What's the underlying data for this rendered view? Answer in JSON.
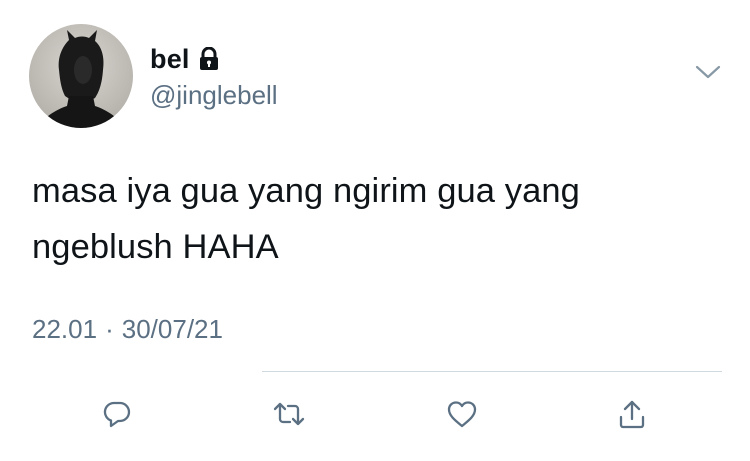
{
  "author": {
    "display_name": "bel",
    "handle": "@jinglebell",
    "verified_icon": "lock-icon"
  },
  "tweet": {
    "text_line_1": "masa iya gua yang ngirim gua yang",
    "text_line_2": "ngeblush HAHA",
    "time": "22.01",
    "separator": "·",
    "date": "30/07/21"
  },
  "actions": [
    {
      "name": "reply",
      "icon": "comment-icon"
    },
    {
      "name": "retweet",
      "icon": "retweet-icon"
    },
    {
      "name": "like",
      "icon": "heart-icon"
    },
    {
      "name": "share",
      "icon": "share-icon"
    }
  ],
  "colors": {
    "text": "#0f1419",
    "secondary": "#5b7083",
    "divider": "#cfd9de"
  }
}
